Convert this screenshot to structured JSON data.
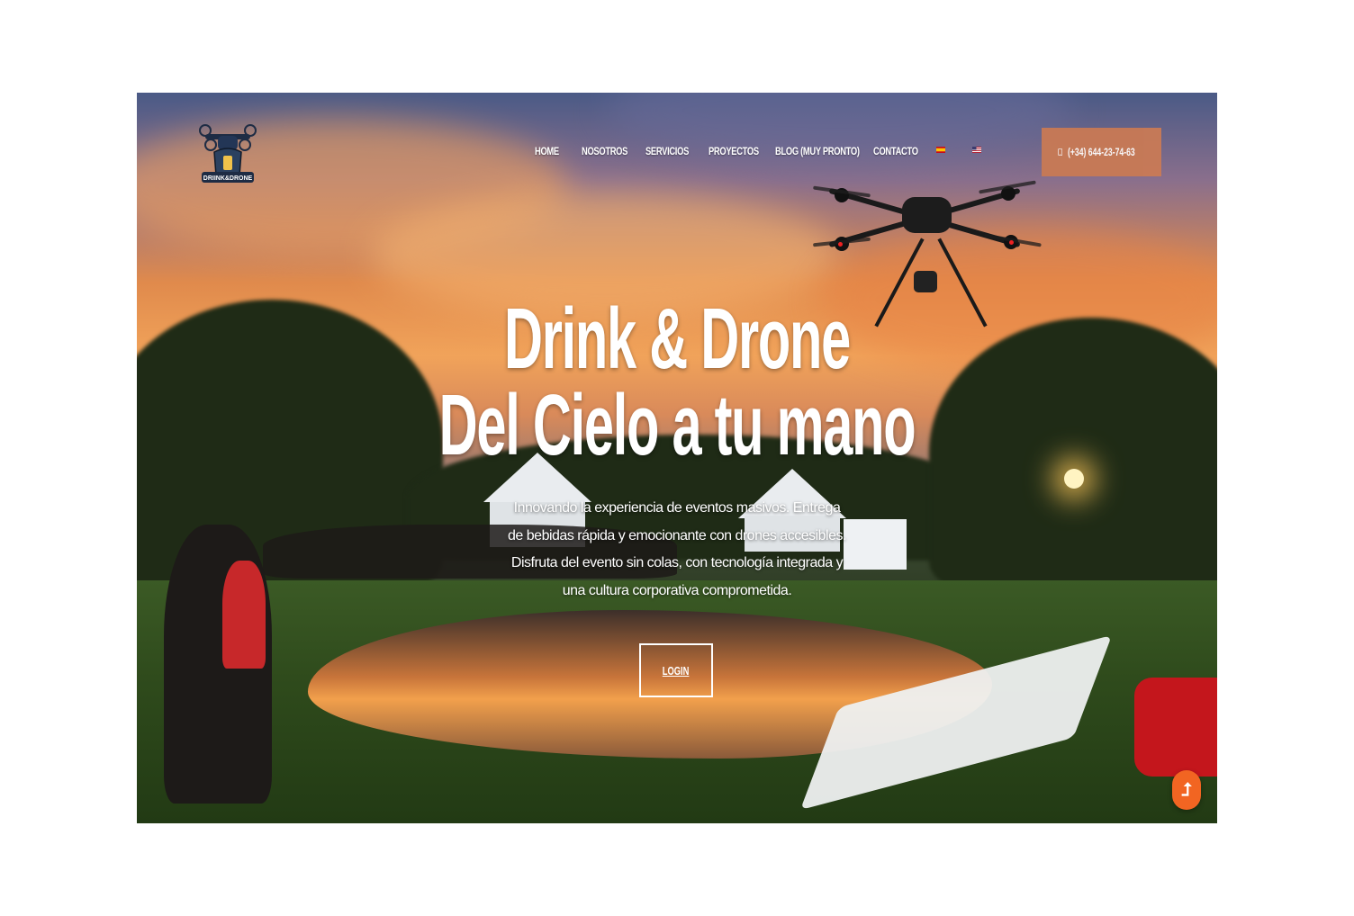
{
  "brand": {
    "logo_text": "DRIINK&DRONE",
    "logo_icon": "drone-logo-icon"
  },
  "nav": {
    "items": [
      "HOME",
      "NOSOTROS",
      "SERVICIOS",
      "PROYECTOS",
      "BLOG (MUY PRONTO)",
      "CONTACTO"
    ],
    "flags": [
      "spain-flag-icon",
      "usa-flag-icon"
    ]
  },
  "phone": {
    "label": "(+34) 644-23-74-63",
    "icon": "mobile-phone-icon",
    "color": "#c97a55"
  },
  "hero": {
    "title_line1": "Drink & Drone",
    "title_line2": "Del Cielo a tu mano",
    "description": "Innovando la experiencia de eventos masivos. Entrega de bebidas rápida y emocionante con drones accesibles. Disfruta del evento sin colas, con tecnología integrada y una cultura corporativa comprometida.",
    "login_label": "LOGIN"
  },
  "scroll_top": {
    "icon": "arrow-up-icon",
    "color": "#f26522",
    "glyph": "⮥"
  }
}
